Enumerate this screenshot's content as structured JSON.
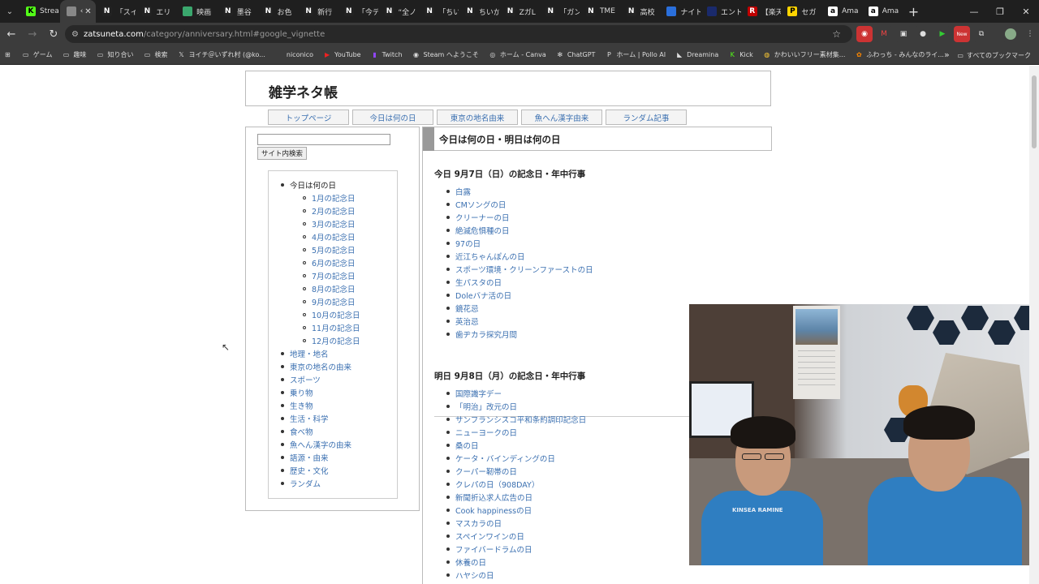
{
  "browser": {
    "tabs": [
      {
        "label": "Strea",
        "icon_color": "#53fc18",
        "icon_text": "K"
      },
      {
        "label": "‹",
        "icon_color": "#888888",
        "icon_text": "",
        "active": true
      },
      {
        "label": "「スイ",
        "icon_color": "#222222",
        "icon_text": "N"
      },
      {
        "label": "エリ",
        "icon_color": "#222222",
        "icon_text": "N"
      },
      {
        "label": "映画",
        "icon_color": "#3aa76d",
        "icon_text": ""
      },
      {
        "label": "墨谷",
        "icon_color": "#222222",
        "icon_text": "N"
      },
      {
        "label": "お色",
        "icon_color": "#222222",
        "icon_text": "N"
      },
      {
        "label": "新行",
        "icon_color": "#222222",
        "icon_text": "N"
      },
      {
        "label": "「今デ",
        "icon_color": "#222222",
        "icon_text": "N"
      },
      {
        "label": "“全ノ",
        "icon_color": "#222222",
        "icon_text": "N"
      },
      {
        "label": "「ちい",
        "icon_color": "#222222",
        "icon_text": "N"
      },
      {
        "label": "ちいか",
        "icon_color": "#222222",
        "icon_text": "N"
      },
      {
        "label": "ZガL",
        "icon_color": "#222222",
        "icon_text": "N"
      },
      {
        "label": "「ガン",
        "icon_color": "#222222",
        "icon_text": "N"
      },
      {
        "label": "TME",
        "icon_color": "#222222",
        "icon_text": "N"
      },
      {
        "label": "高校",
        "icon_color": "#222222",
        "icon_text": "N"
      },
      {
        "label": "ナイト",
        "icon_color": "#2a6fdb",
        "icon_text": ""
      },
      {
        "label": "エント",
        "icon_color": "#1a2a6c",
        "icon_text": ""
      },
      {
        "label": "【楽天",
        "icon_color": "#bf0000",
        "icon_text": "R"
      },
      {
        "label": "セガ",
        "icon_color": "#ffd400",
        "icon_text": "P"
      },
      {
        "label": "Ama",
        "icon_color": "#ffffff",
        "icon_text": "a"
      },
      {
        "label": "Ama",
        "icon_color": "#ffffff",
        "icon_text": "a"
      }
    ],
    "new_tab": "+",
    "url_domain": "zatsuneta.com",
    "url_path": "/category/anniversary.html#google_vignette",
    "bookmarks": [
      {
        "label": "ゲーム",
        "icon": "folder-icon"
      },
      {
        "label": "趣味",
        "icon": "folder-icon"
      },
      {
        "label": "知り合い",
        "icon": "folder-icon"
      },
      {
        "label": "検索",
        "icon": "folder-icon"
      },
      {
        "label": "ヨイチ＠いずれ村 (@ko...",
        "icon": "x-icon"
      },
      {
        "label": "niconico",
        "icon": "niconico-icon"
      },
      {
        "label": "YouTube",
        "icon": "youtube-icon"
      },
      {
        "label": "Twitch",
        "icon": "twitch-icon"
      },
      {
        "label": "Steam へようこそ",
        "icon": "steam-icon"
      },
      {
        "label": "ホーム - Canva",
        "icon": "canva-icon"
      },
      {
        "label": "ChatGPT",
        "icon": "chatgpt-icon"
      },
      {
        "label": "ホーム | Pollo AI",
        "icon": "pollo-icon"
      },
      {
        "label": "Dreamina",
        "icon": "dreamina-icon"
      },
      {
        "label": "Kick",
        "icon": "kick-icon"
      },
      {
        "label": "かわいいフリー素材集...",
        "icon": "irasutoya-icon"
      },
      {
        "label": "ふわっち - みんなのライ...",
        "icon": "fuwacchi-icon"
      }
    ],
    "bookmarks_more": "»",
    "all_bookmarks": "すべてのブックマーク"
  },
  "site": {
    "title": "雑学ネタ帳",
    "nav": [
      "トップページ",
      "今日は何の日",
      "東京の地名由来",
      "魚へん漢字由来",
      "ランダム記事"
    ],
    "search_button": "サイト内検索",
    "sidebar": {
      "anniversary": "今日は何の日",
      "months": [
        "1月の記念日",
        "2月の記念日",
        "3月の記念日",
        "4月の記念日",
        "5月の記念日",
        "6月の記念日",
        "7月の記念日",
        "8月の記念日",
        "9月の記念日",
        "10月の記念日",
        "11月の記念日",
        "12月の記念日"
      ],
      "categories": [
        "地理・地名",
        "東京の地名の由来",
        "スポーツ",
        "乗り物",
        "生き物",
        "生活・科学",
        "食べ物",
        "魚へん漢字の由来",
        "語源・由来",
        "歴史・文化",
        "ランダム"
      ]
    },
    "main": {
      "title": "今日は何の日・明日は何の日",
      "today_head": "今日 9月7日（日）の記念日・年中行事",
      "today_events": [
        "白露",
        "CMソングの日",
        "クリーナーの日",
        "絶滅危惧種の日",
        "97の日",
        "近江ちゃんぽんの日",
        "スポーツ環境・クリーンファーストの日",
        "生パスタの日",
        "Doleバナ活の日",
        "鏡花忌",
        "英治忌",
        "歯ヂカラ探究月間"
      ],
      "tomorrow_head": "明日 9月8日（月）の記念日・年中行事",
      "tomorrow_events": [
        "国際識字デー",
        "「明治」改元の日",
        "サンフランシスコ平和条約調印記念日",
        "ニューヨークの日",
        "桑の日",
        "ケータ・バインディングの日",
        "クーパー靭帯の日",
        "クレパの日（908DAY）",
        "新聞折込求人広告の日",
        "Cook happinessの日",
        "マスカラの日",
        "スペインワインの日",
        "ファイバードラムの日",
        "休養の日",
        "ハヤシの日"
      ]
    }
  },
  "webcam": {
    "shirt_text": "KINSEA RAMINE"
  }
}
